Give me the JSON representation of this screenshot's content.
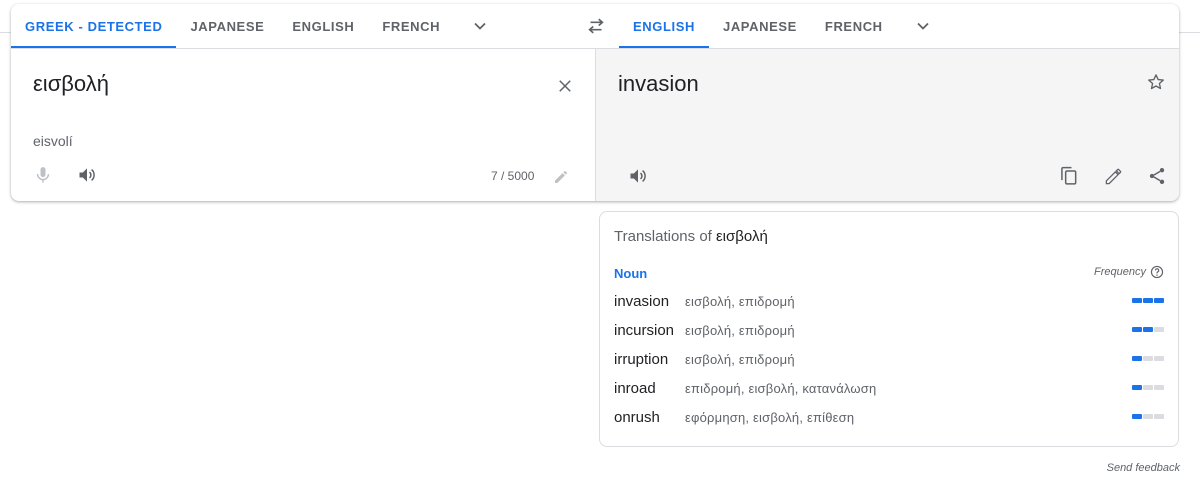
{
  "source_languages": {
    "tabs": [
      "GREEK - DETECTED",
      "JAPANESE",
      "ENGLISH",
      "FRENCH"
    ],
    "active_index": 0
  },
  "target_languages": {
    "tabs": [
      "ENGLISH",
      "JAPANESE",
      "FRENCH"
    ],
    "active_index": 0
  },
  "source": {
    "text": "εισβολή",
    "transliteration": "eisvolí",
    "char_count": "7 / 5000"
  },
  "target": {
    "text": "invasion"
  },
  "dictionary": {
    "title_prefix": "Translations of",
    "title_word": "εισβολή",
    "part_of_speech": "Noun",
    "frequency_label": "Frequency",
    "entries": [
      {
        "word": "invasion",
        "synonyms": "εισβολή, επιδρομή",
        "frequency": 3
      },
      {
        "word": "incursion",
        "synonyms": "εισβολή, επιδρομή",
        "frequency": 2
      },
      {
        "word": "irruption",
        "synonyms": "εισβολή, επιδρομή",
        "frequency": 1
      },
      {
        "word": "inroad",
        "synonyms": "επιδρομή, εισβολή, κατανάλωση",
        "frequency": 1
      },
      {
        "word": "onrush",
        "synonyms": "εφόρμηση, εισβολή, επίθεση",
        "frequency": 1
      }
    ]
  },
  "footer": {
    "feedback": "Send feedback"
  },
  "colors": {
    "accent": "#1a73e8",
    "muted_bar": "#dadce0",
    "target_background": "#f5f5f5"
  }
}
